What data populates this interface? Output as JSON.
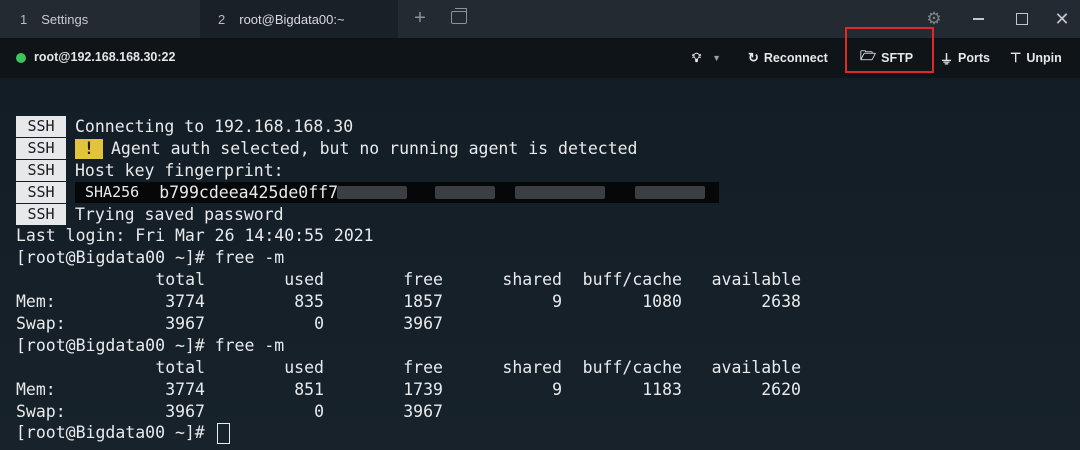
{
  "tabs": [
    {
      "num": "1",
      "label": "Settings"
    },
    {
      "num": "2",
      "label": "root@Bigdata00:~"
    }
  ],
  "window_controls": {
    "settings_icon": "gear-icon",
    "minimize": "minimize-icon",
    "maximize": "maximize-icon",
    "close": "close-icon"
  },
  "toolbar": {
    "host": "root@192.168.168.30:22",
    "status_color": "#3fc45a",
    "reconnect": "Reconnect",
    "sftp": "SFTP",
    "ports": "Ports",
    "unpin": "Unpin",
    "highlight_color": "#e02a2a"
  },
  "terminal": {
    "ssh_tag": "SSH",
    "warn_tag": "!",
    "sha_tag": "SHA256",
    "ssh_lines": [
      "Connecting to 192.168.168.30",
      "Agent auth selected, but no running agent is detected",
      "Host key fingerprint:",
      "b799cdeea425de0ff7",
      "Trying saved password"
    ],
    "last_login": "Last login: Fri Mar 26 14:40:55 2021",
    "prompt": "[root@Bigdata00 ~]#",
    "command": "free -m",
    "headers": [
      "total",
      "used",
      "free",
      "shared",
      "buff/cache",
      "available"
    ],
    "free_runs": [
      {
        "mem": {
          "label": "Mem:",
          "total": "3774",
          "used": "835",
          "free": "1857",
          "shared": "9",
          "buff_cache": "1080",
          "available": "2638"
        },
        "swap": {
          "label": "Swap:",
          "total": "3967",
          "used": "0",
          "free": "3967"
        }
      },
      {
        "mem": {
          "label": "Mem:",
          "total": "3774",
          "used": "851",
          "free": "1739",
          "shared": "9",
          "buff_cache": "1183",
          "available": "2620"
        },
        "swap": {
          "label": "Swap:",
          "total": "3967",
          "used": "0",
          "free": "3967"
        }
      }
    ]
  }
}
